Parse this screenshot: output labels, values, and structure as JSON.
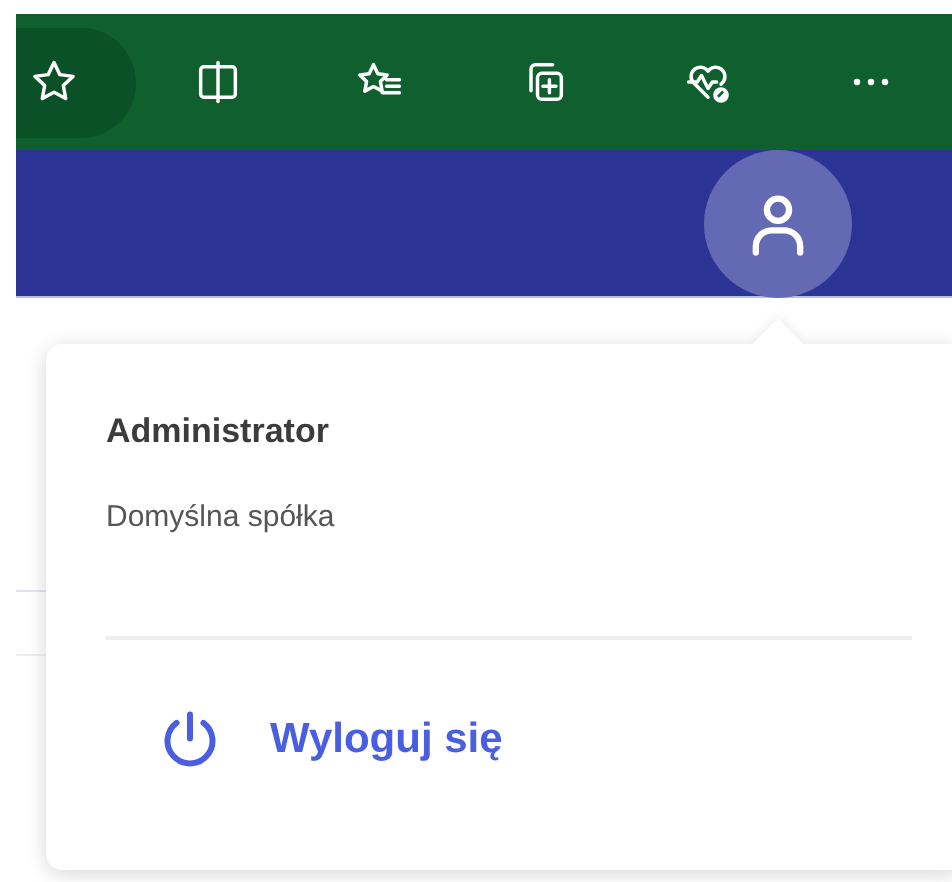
{
  "browser_toolbar": {
    "buttons": [
      {
        "kind": "star"
      },
      {
        "kind": "split"
      },
      {
        "kind": "favorites"
      },
      {
        "kind": "collections"
      },
      {
        "kind": "health"
      },
      {
        "kind": "more"
      }
    ]
  },
  "account_menu": {
    "user_name": "Administrator",
    "company": "Domyślna spółka",
    "logout": "Wyloguj się"
  }
}
